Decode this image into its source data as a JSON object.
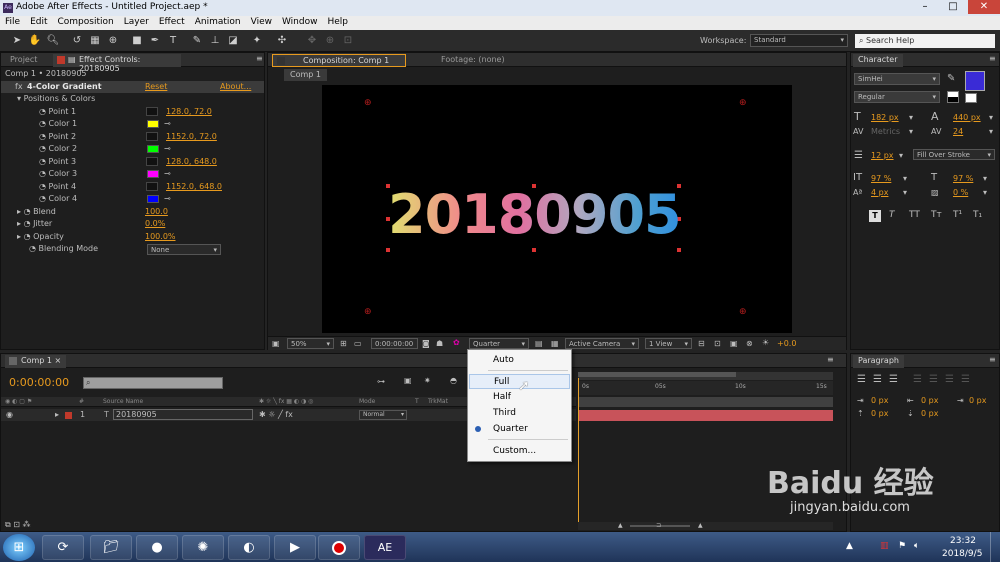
{
  "window": {
    "title": "Adobe After Effects - Untitled Project.aep *",
    "logo": "Ae"
  },
  "menu": [
    "File",
    "Edit",
    "Composition",
    "Layer",
    "Effect",
    "Animation",
    "View",
    "Window",
    "Help"
  ],
  "toolbar": {
    "workspace_label": "Workspace:",
    "workspace_value": "Standard",
    "search_placeholder": "Search Help"
  },
  "project_panel": {
    "tab_project": "Project",
    "tab_effect_controls": "Effect Controls: 20180905",
    "breadcrumb": "Comp 1 • 20180905",
    "effect_name": "4-Color Gradient",
    "reset": "Reset",
    "about": "About...",
    "group_label": "Positions & Colors",
    "params": [
      {
        "label": "Point 1",
        "value": "128.0, 72.0"
      },
      {
        "label": "Color 1",
        "color": "#ffff00"
      },
      {
        "label": "Point 2",
        "value": "1152.0, 72.0"
      },
      {
        "label": "Color 2",
        "color": "#00ff00"
      },
      {
        "label": "Point 3",
        "value": "128.0, 648.0"
      },
      {
        "label": "Color 3",
        "color": "#ff00ff"
      },
      {
        "label": "Point 4",
        "value": "1152.0, 648.0"
      },
      {
        "label": "Color 4",
        "color": "#0000ff"
      }
    ],
    "blend": {
      "label": "Blend",
      "value": "100.0"
    },
    "jitter": {
      "label": "Jitter",
      "value": "0.0%"
    },
    "opacity": {
      "label": "Opacity",
      "value": "100.0%"
    },
    "blending_mode": {
      "label": "Blending Mode",
      "value": "None"
    }
  },
  "composition": {
    "tab": "Composition: Comp 1",
    "footage_tab": "Footage: (none)",
    "sub_tab": "Comp 1",
    "text": "20180905",
    "zoom": "50%",
    "timecode": "0:00:00:00",
    "resolution": "Quarter",
    "camera": "Active Camera",
    "view": "1 View",
    "exposure": "+0.0"
  },
  "resolution_menu": {
    "items": [
      "Auto",
      "Full",
      "Half",
      "Third",
      "Quarter",
      "Custom..."
    ],
    "highlighted": "Full",
    "checked": "Quarter"
  },
  "character": {
    "tab": "Character",
    "font": "SimHei",
    "style": "Regular",
    "size": "182 px",
    "leading": "440 px",
    "kerning": "Metrics",
    "tracking": "24",
    "stroke_width": "12 px",
    "stroke_type": "Fill Over Stroke",
    "vscale": "97 %",
    "hscale": "97 %",
    "baseline": "4 px",
    "tsume": "0 %",
    "fill_color": "#3a2bd6",
    "style_buttons": [
      "T",
      "T",
      "TT",
      "Tт",
      "T¹",
      "T₁"
    ]
  },
  "paragraph": {
    "tab": "Paragraph",
    "indent_values": [
      "0 px",
      "0 px",
      "0 px",
      "0 px",
      "0 px"
    ]
  },
  "timeline": {
    "tab": "Comp 1",
    "timecode": "0:00:00:00",
    "columns": [
      "Source Name",
      "Mode",
      "T",
      "TrkMat"
    ],
    "layer": {
      "index": "1",
      "name": "20180905",
      "mode": "Normal"
    },
    "ruler": [
      "0s",
      "05s",
      "10s",
      "15s"
    ]
  },
  "taskbar": {
    "time": "23:32",
    "date": "2018/9/5",
    "ae_label": "AE"
  },
  "watermark": {
    "brand": "Baidu 经验",
    "url": "jingyan.baidu.com"
  }
}
